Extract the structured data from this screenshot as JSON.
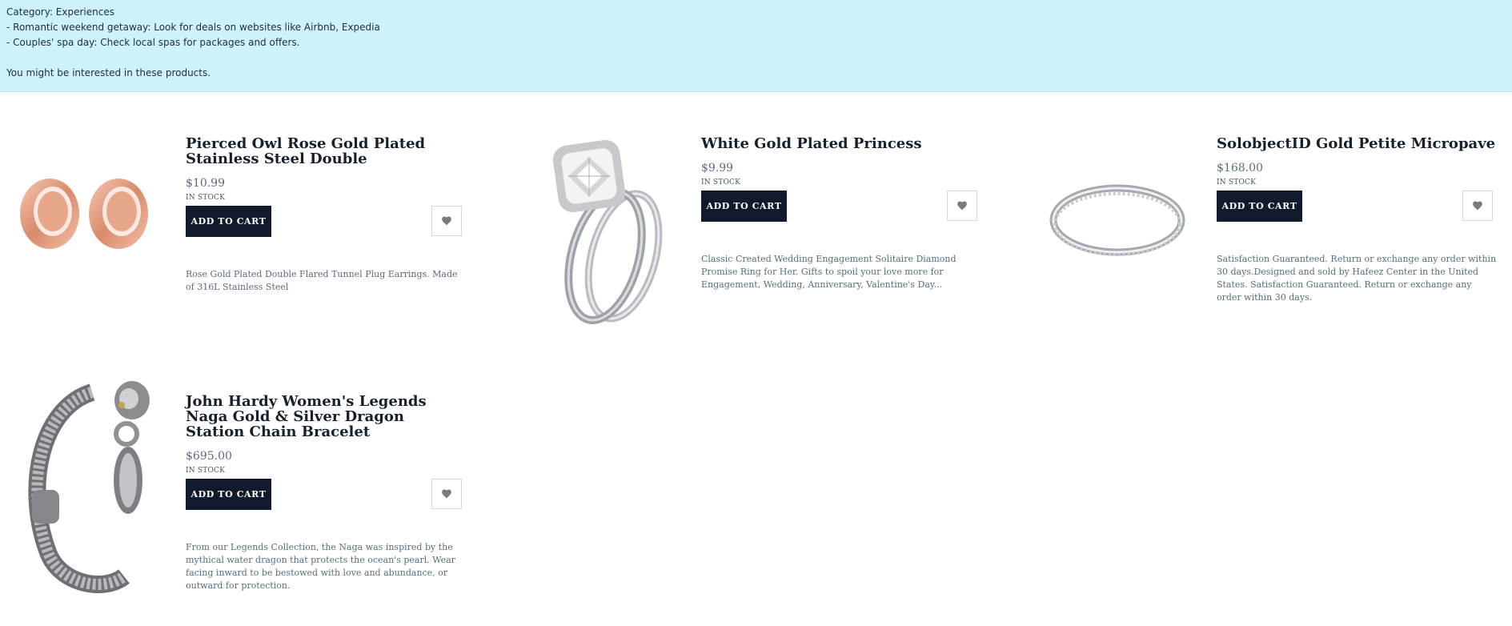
{
  "banner": {
    "lines": [
      "Category: Experiences",
      "- Romantic weekend getaway: Look for deals on websites like Airbnb, Expedia",
      "- Couples' spa day: Check local spas for packages and offers.",
      "",
      "You might be interested in these products."
    ]
  },
  "products": [
    {
      "title": "Pierced Owl Rose Gold Plated Stainless Steel Double",
      "price": "$10.99",
      "stock": "IN STOCK",
      "cart_label": "ADD TO CART",
      "description": "Rose Gold Plated Double Flared Tunnel Plug Earrings. Made of 316L Stainless Steel",
      "image_icon": "tunnel-earrings-image"
    },
    {
      "title": "White Gold Plated Princess",
      "price": "$9.99",
      "stock": "IN STOCK",
      "cart_label": "ADD TO CART",
      "description": "Classic Created Wedding Engagement Solitaire Diamond Promise Ring for Her. Gifts to spoil your love more for Engagement, Wedding, Anniversary, Valentine's Day...",
      "image_icon": "engagement-ring-image"
    },
    {
      "title": "SolobjectID Gold Petite Micropave",
      "price": "$168.00",
      "stock": "IN STOCK",
      "cart_label": "ADD TO CART",
      "description": "Satisfaction Guaranteed. Return or exchange any order within 30 days.Designed and sold by Hafeez Center in the United States. Satisfaction Guaranteed. Return or exchange any order within 30 days.",
      "image_icon": "micropave-band-image"
    },
    {
      "title": "John Hardy Women's Legends Naga Gold & Silver Dragon Station Chain Bracelet",
      "price": "$695.00",
      "stock": "IN STOCK",
      "cart_label": "ADD TO CART",
      "description": "From our Legends Collection, the Naga was inspired by the mythical water dragon that protects the ocean's pearl. Wear facing inward to be bestowed with love and abundance, or outward for protection.",
      "image_icon": "dragon-bracelet-image"
    }
  ],
  "colors": {
    "banner_bg": "#cdf2f9",
    "button_bg": "#111a2c",
    "price_text": "#5b6b7e",
    "heart_icon": "#7a7a7a"
  }
}
